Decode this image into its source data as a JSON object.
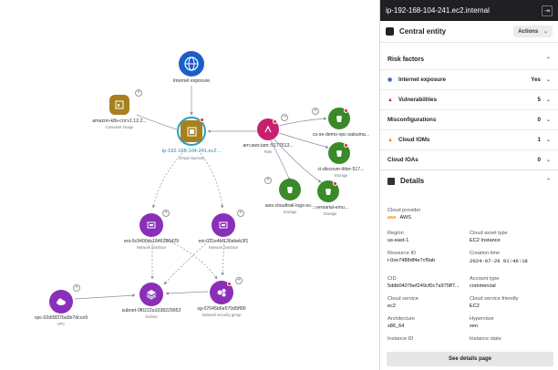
{
  "graph": {
    "internet": {
      "label": "Internet exposure"
    },
    "container_image": {
      "label": "amazon-k8s-cni:v1.12.2...",
      "sub": "Container image"
    },
    "vm": {
      "label": "ip-192-168-104-241.ec2...",
      "sub": "Virtual machine"
    },
    "role": {
      "label": "arn:aws:iam::5177613...",
      "sub": "Role"
    },
    "bucket1": {
      "label": "cs-se-demo-vpc-salsuma...",
      "sub": "Storage"
    },
    "bucket2": {
      "label": "ci-discover-litter-517...",
      "sub": "Storage"
    },
    "bucket3": {
      "label": "aws-cloudtrail-logs-so...",
      "sub": "Storage"
    },
    "bucket4": {
      "label": "...versarial-emu...",
      "sub": "Storage"
    },
    "eni1": {
      "label": "eni-0c9400dc1846280d29",
      "sub": "Network interface"
    },
    "eni2": {
      "label": "eni-031e4bf136ebeb3f1",
      "sub": "Network interface"
    },
    "vpc": {
      "label": "vpc-02d0837ba5b7dcce9",
      "sub": "VPC"
    },
    "subnet": {
      "label": "subnet-0f0222a1038229952",
      "sub": "Subnet"
    },
    "sg": {
      "label": "sg-07045b6e570d5f6f0",
      "sub": "Network security group"
    }
  },
  "panel": {
    "title": "ip-192-168-104-241.ec2.internal",
    "central_entity": "Central entity",
    "actions_label": "Actions",
    "risk_factors_title": "Risk factors",
    "risks": [
      {
        "label": "Internet exposure",
        "value": "Yes",
        "icon": "globe-icon",
        "color": "#2a66d4"
      },
      {
        "label": "Vulnerabilities",
        "value": "5",
        "icon": "triangle-icon",
        "color": "#d8262f"
      },
      {
        "label": "Misconfigurations",
        "value": "0",
        "icon": "",
        "color": "#222"
      },
      {
        "label": "Cloud IOMs",
        "value": "1",
        "icon": "triangle-icon",
        "color": "#e8811e"
      },
      {
        "label": "Cloud IOAs",
        "value": "0",
        "icon": "",
        "color": "#222"
      }
    ],
    "details_title": "Details",
    "details": {
      "cloud_provider_k": "Cloud provider",
      "cloud_provider_v": "AWS",
      "region_k": "Region",
      "region_v": "us-east-1",
      "asset_type_k": "Cloud asset type",
      "asset_type_v": "EC2 Instance",
      "resource_id_k": "Resource ID",
      "resource_id_v": "i-0ze7488df4e7cf9ab",
      "creation_k": "Creation time",
      "creation_v": "2024-07-26 01:46:18",
      "cid_k": "CID",
      "cid_v": "5ddb0407bef249cf0c7a975ff7...",
      "account_type_k": "Account type",
      "account_type_v": "commercial",
      "cloud_service_k": "Cloud service",
      "cloud_service_v": "ec2",
      "cloud_service_friendly_k": "Cloud service friendly",
      "cloud_service_friendly_v": "EC2",
      "arch_k": "Architecture",
      "arch_v": "x86_64",
      "hypervisor_k": "Hypervisor",
      "hypervisor_v": "xen",
      "instance_id_k": "Instance ID",
      "instance_state_k": "Instance state"
    },
    "footer_button": "See details page"
  }
}
